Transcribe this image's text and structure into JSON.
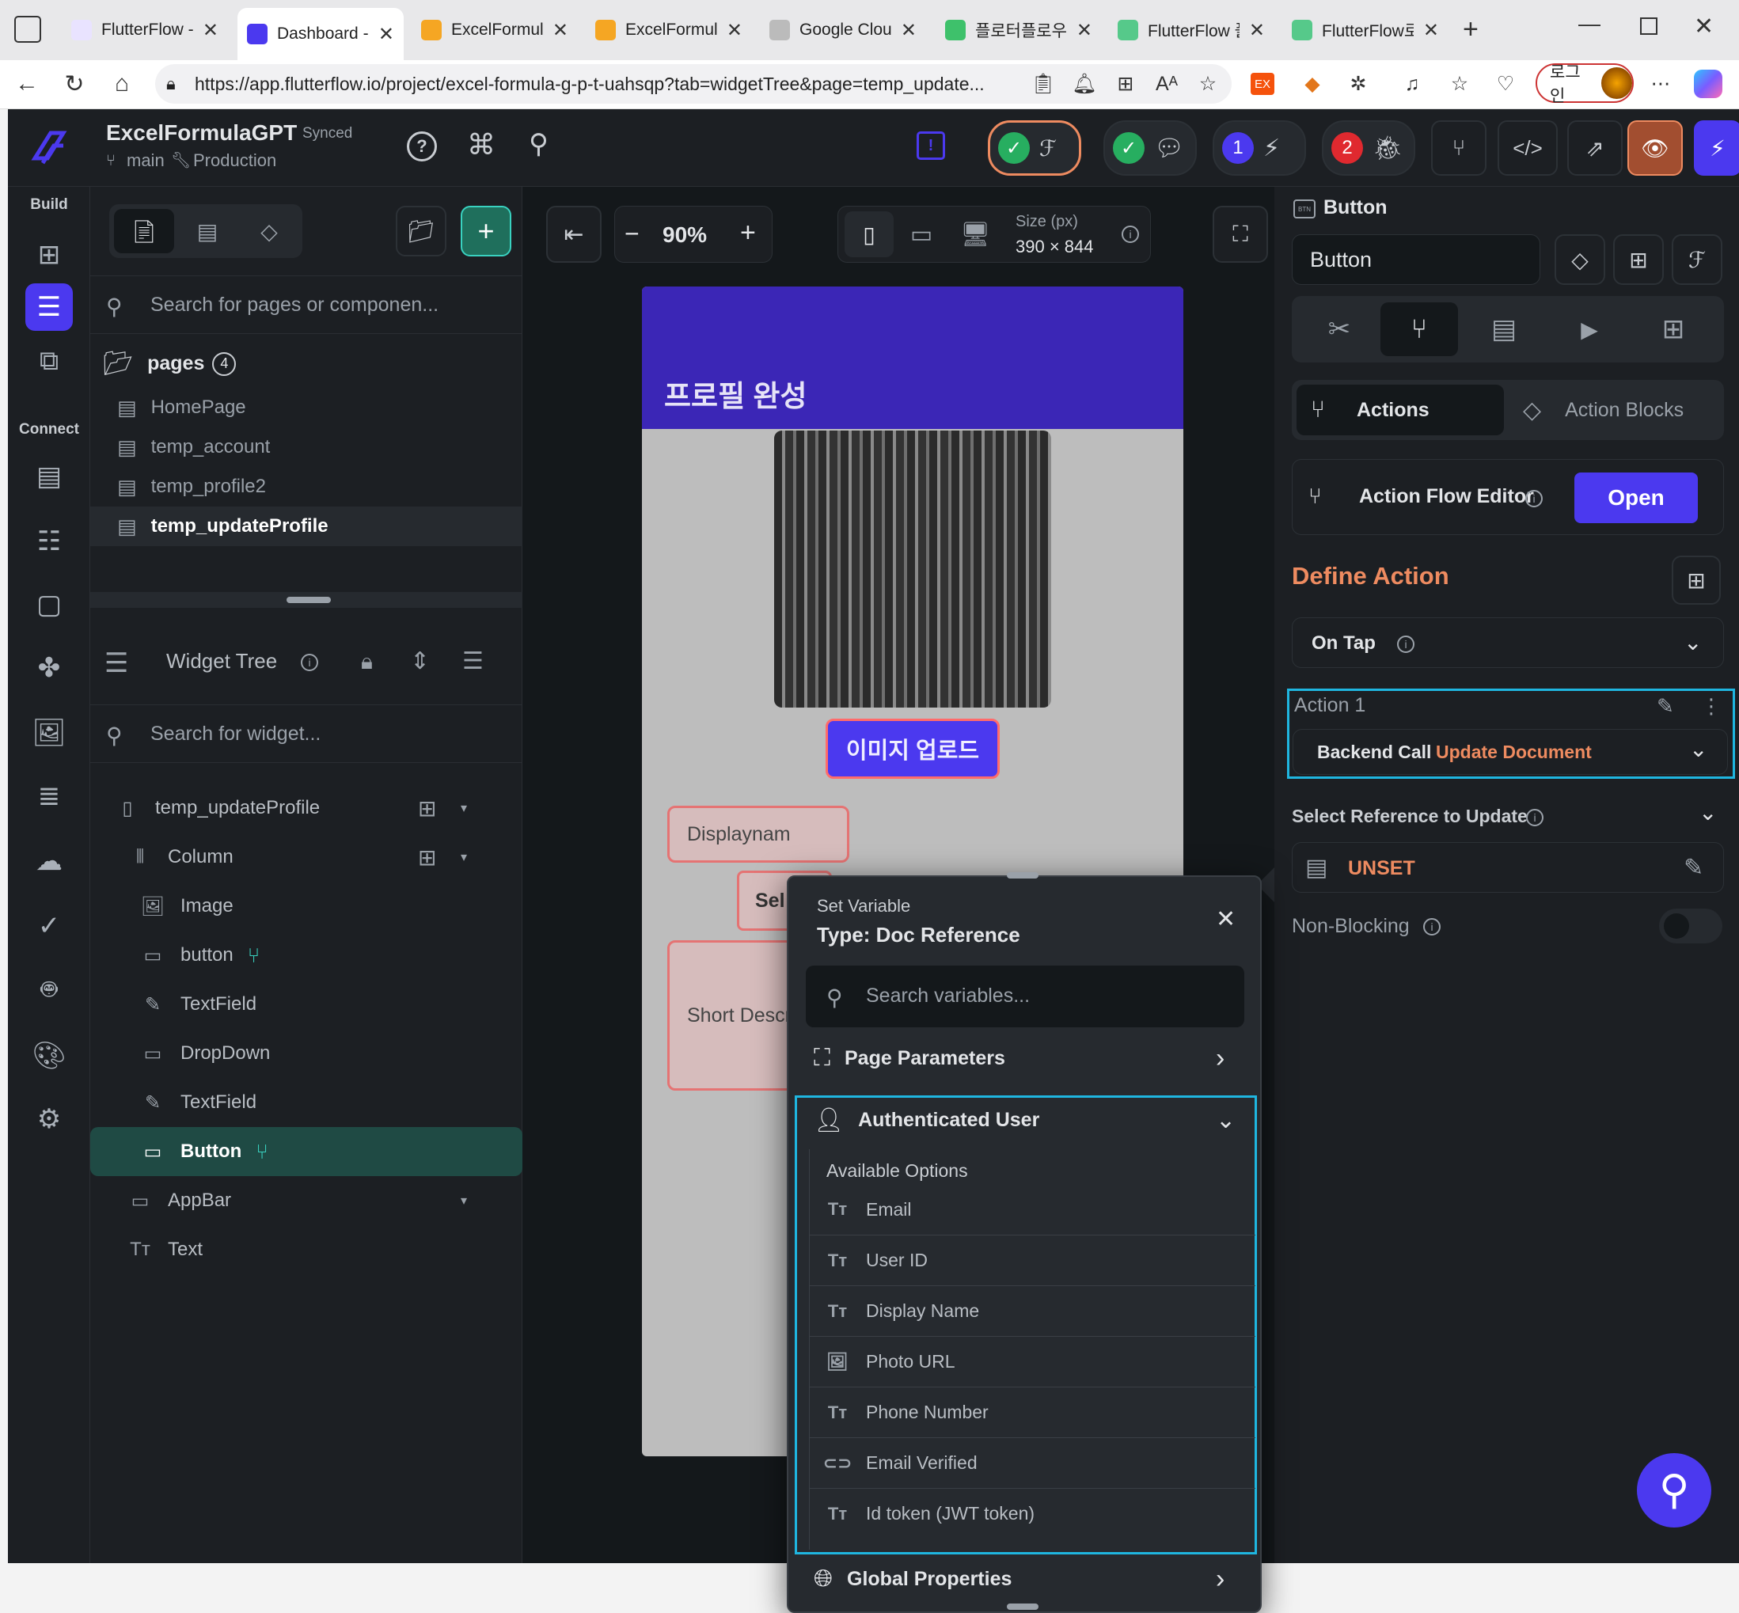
{
  "tabs": [
    {
      "label": "FlutterFlow - I",
      "color": "#e9e3ff",
      "active": false
    },
    {
      "label": "Dashboard - F",
      "color": "#4b39ef",
      "active": true
    },
    {
      "label": "ExcelFormula",
      "color": "#f5a623",
      "active": false
    },
    {
      "label": "ExcelFormula",
      "color": "#f5a623",
      "active": false
    },
    {
      "label": "Google Cloud",
      "color": "#bbbbbb",
      "active": false
    },
    {
      "label": "플로터플로우",
      "color": "#3ec16b",
      "active": false
    },
    {
      "label": "FlutterFlow 플",
      "color": "#56c98a",
      "active": false
    },
    {
      "label": "FlutterFlow로",
      "color": "#56c98a",
      "active": false
    }
  ],
  "browser": {
    "url": "https://app.flutterflow.io/project/excel-formula-g-p-t-uahsqp?tab=widgetTree&page=temp_update...",
    "login": "로그인"
  },
  "project": {
    "name": "ExcelFormulaGPT",
    "status": "Synced",
    "branch": "main",
    "env": "Production"
  },
  "topbar": {
    "badge_run": "1",
    "badge_bugs": "2"
  },
  "rail": {
    "build": "Build",
    "connect": "Connect"
  },
  "pages": {
    "search_placeholder": "Search for pages or componen...",
    "folder": "pages",
    "count": "4",
    "items": [
      "HomePage",
      "temp_account",
      "temp_profile2",
      "temp_updateProfile"
    ]
  },
  "widget_tree": {
    "title": "Widget Tree",
    "search_placeholder": "Search for widget...",
    "nodes": [
      {
        "label": "temp_updateProfile",
        "icon": "phone-icon"
      },
      {
        "label": "Column",
        "icon": "column-icon"
      },
      {
        "label": "Image",
        "icon": "image-icon"
      },
      {
        "label": "button",
        "icon": "button-icon"
      },
      {
        "label": "TextField",
        "icon": "textfield-icon"
      },
      {
        "label": "DropDown",
        "icon": "dropdown-icon"
      },
      {
        "label": "TextField",
        "icon": "textfield-icon"
      },
      {
        "label": "Button",
        "icon": "button-icon"
      },
      {
        "label": "AppBar",
        "icon": "appbar-icon"
      },
      {
        "label": "Text",
        "icon": "text-icon"
      }
    ]
  },
  "canvas": {
    "zoom": "90%",
    "size_label": "Size (px)",
    "size_value": "390 × 844",
    "appbar_title": "프로필 완성",
    "upload_button": "이미지 업로드",
    "field1": "Displaynam",
    "field2": "Sel",
    "field3": "Short Descr"
  },
  "popup": {
    "header": "Set Variable",
    "type": "Type: Doc Reference",
    "search_placeholder": "Search variables...",
    "page_params": "Page Parameters",
    "auth_user": "Authenticated User",
    "available": "Available Options",
    "options": [
      "Email",
      "User ID",
      "Display Name",
      "Photo URL",
      "Phone Number",
      "Email Verified",
      "Id token (JWT token)"
    ],
    "global": "Global Properties"
  },
  "right": {
    "widget_type": "Button",
    "widget_name": "Button",
    "tab_actions": "Actions",
    "tab_blocks": "Action Blocks",
    "flow_editor": "Action Flow Editor",
    "open": "Open",
    "define": "Define Action",
    "trigger": "On Tap",
    "action_label": "Action 1",
    "backend": "Backend Call",
    "backend_op": "Update Document",
    "ref_label": "Select Reference to Update",
    "unset": "UNSET",
    "nonblocking": "Non-Blocking"
  },
  "colors": {
    "accent": "#4b39ef",
    "orange": "#ee8b60",
    "teal": "#39d2c0",
    "highlight": "#1fb6e0"
  }
}
